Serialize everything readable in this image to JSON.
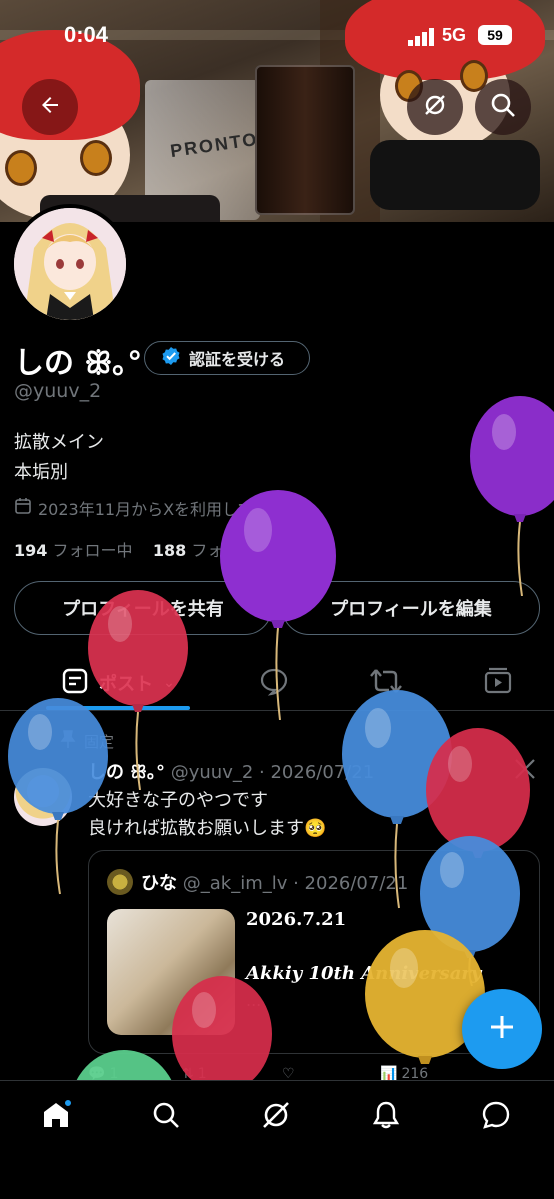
{
  "status_bar": {
    "time": "0:04",
    "network": "5G",
    "battery": "59"
  },
  "banner": {
    "cup_brand": "PRONTO"
  },
  "profile": {
    "display_name": "しの ꕥ｡°",
    "verify_label": "認証を受ける",
    "handle": "@yuuv_2",
    "bio_line1": "拡散メイン",
    "bio_line2": "本垢別",
    "joined": "2023年11月からXを利用しています",
    "following_count": "194",
    "following_label": "フォロー中",
    "followers_count": "188",
    "followers_label": "フォロワー"
  },
  "buttons": {
    "share_profile": "プロフィールを共有",
    "edit_profile": "プロフィールを編集"
  },
  "tabs": {
    "posts": "ポスト"
  },
  "pinned_post": {
    "pinned_label": "固定",
    "author_name": "しの ꕥ｡°",
    "author_meta": "@yuuv_2 · 2026/07/21",
    "line1": "大好きな子のやつです",
    "line2": "良ければ拡散お願いします🥺",
    "quote": {
      "author_name": "ひな",
      "author_meta": "@_ak_im_lv · 2026/07/21",
      "title": "2026.7.21",
      "subtitle": "Akkiy 10th Anniversary",
      "ellipsis": "..."
    },
    "actions": {
      "replies": "1",
      "reposts": "1",
      "views": "216"
    }
  },
  "colors": {
    "accent": "#1d9bf0",
    "background": "#000000",
    "secondary_text": "#71767b",
    "border": "#2f3336"
  },
  "icons": {
    "back": "arrow-left-icon",
    "grok": "grok-icon",
    "search": "search-icon",
    "home": "home-icon",
    "notifications": "bell-icon",
    "messages": "message-icon",
    "compose": "plus-icon"
  }
}
